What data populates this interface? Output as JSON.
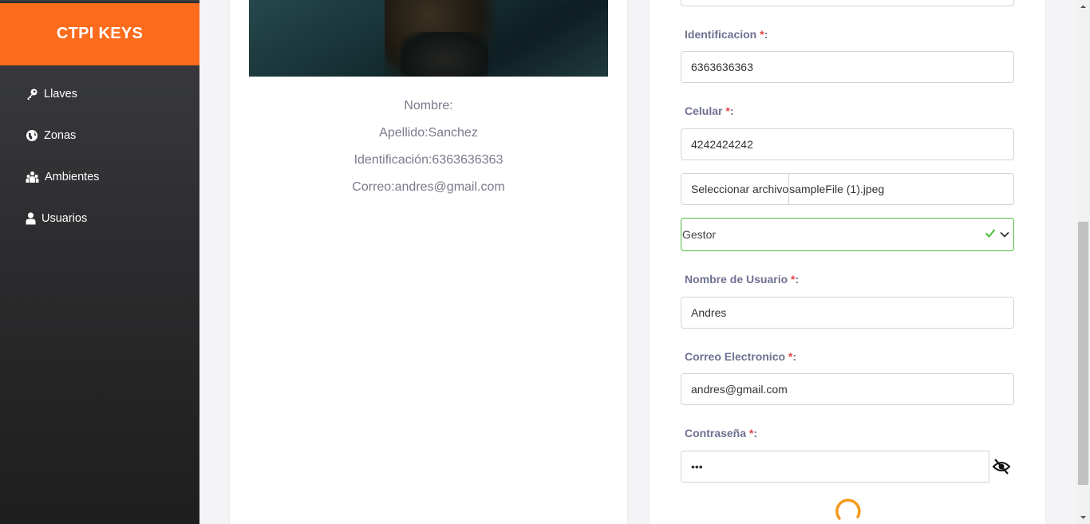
{
  "sidebar": {
    "brand": "CTPI KEYS",
    "items": [
      {
        "label": "Llaves",
        "icon": "key-icon"
      },
      {
        "label": "Zonas",
        "icon": "globe-icon"
      },
      {
        "label": "Ambientes",
        "icon": "people-group-icon"
      },
      {
        "label": "Usuarios",
        "icon": "user-icon"
      }
    ]
  },
  "profile": {
    "nombre": "Nombre:",
    "apellido": "Apellido:Sanchez",
    "identificacion": "Identificación:6363636363",
    "correo": "Correo:andres@gmail.com"
  },
  "form": {
    "identificacion": {
      "label": "Identificacion ",
      "req": "*",
      "colon": ":",
      "value": "6363636363"
    },
    "celular": {
      "label": "Celular ",
      "req": "*",
      "colon": ":",
      "value": "4242424242"
    },
    "file": {
      "button": "Seleccionar archivo",
      "name": "sampleFile (1).jpeg"
    },
    "rol": {
      "value": "Gestor"
    },
    "usuario": {
      "label": "Nombre de Usuario ",
      "req": "*",
      "colon": ":",
      "value": "Andres"
    },
    "correo": {
      "label": "Correo Electronico ",
      "req": "*",
      "colon": ":",
      "value": "andres@gmail.com"
    },
    "password": {
      "label": "Contraseña ",
      "req": "*",
      "colon": ":",
      "value": "•••"
    }
  },
  "colors": {
    "brand": "#fd6b1d",
    "valid": "#4cbb3b",
    "required": "#e64646",
    "label": "#6e7191"
  }
}
